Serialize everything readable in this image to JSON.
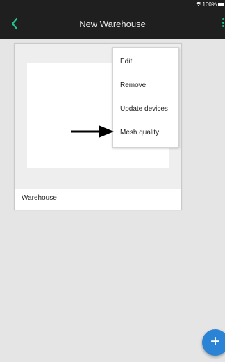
{
  "status_bar": {
    "battery": "100%",
    "wifi_icon": "wifi-icon",
    "battery_icon": "battery-icon"
  },
  "toolbar": {
    "title": "New Warehouse",
    "back_icon": "chevron-left-icon",
    "more_icon": "more-vertical-icon",
    "accent_color": "#23c28a",
    "background_color": "#1f1f1f"
  },
  "card": {
    "label": "Warehouse"
  },
  "menu": {
    "items": [
      {
        "label": "Edit"
      },
      {
        "label": "Remove"
      },
      {
        "label": "Update devices"
      },
      {
        "label": "Mesh quality"
      }
    ]
  },
  "fab": {
    "label": "+",
    "color": "#2b83d6"
  }
}
